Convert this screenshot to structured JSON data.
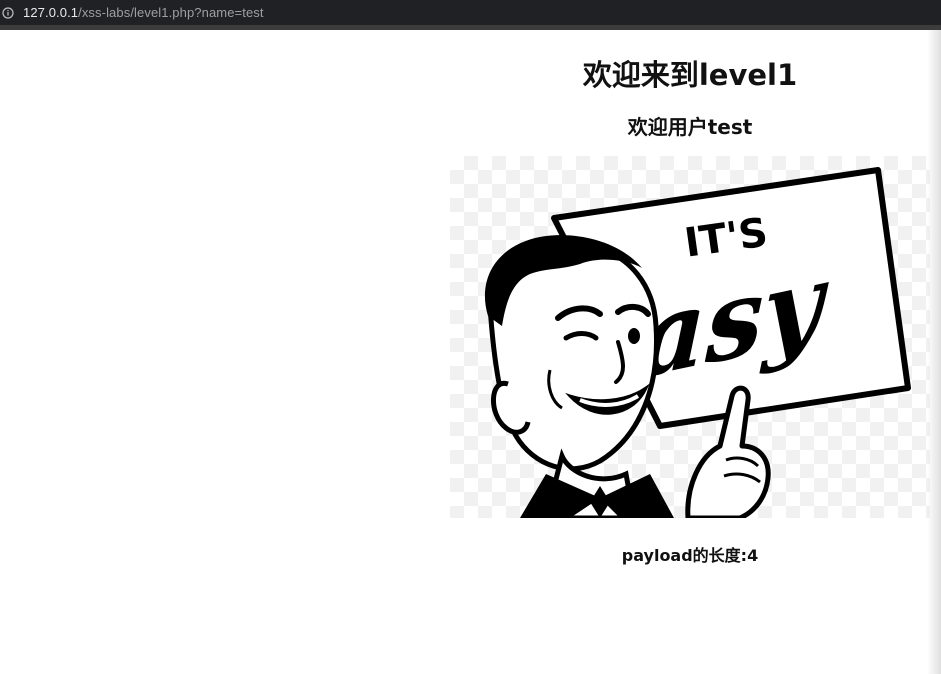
{
  "browser": {
    "url_host": "127.0.0.1",
    "url_path": "/xss-labs/level1.php?name=test",
    "info_icon": "info-icon"
  },
  "page": {
    "title": "欢迎来到level1",
    "welcome": "欢迎用户test",
    "image": {
      "sign_top_text": "IT'S",
      "sign_main_text": "Easy",
      "icon": "cartoon-man-pointing-at-sign"
    },
    "payload_length": "payload的长度:4"
  },
  "colors": {
    "browser_bar": "#202124",
    "url_host": "#e8eaed",
    "url_path": "#9aa0a6",
    "page_bg": "#ffffff",
    "text": "#111111"
  }
}
